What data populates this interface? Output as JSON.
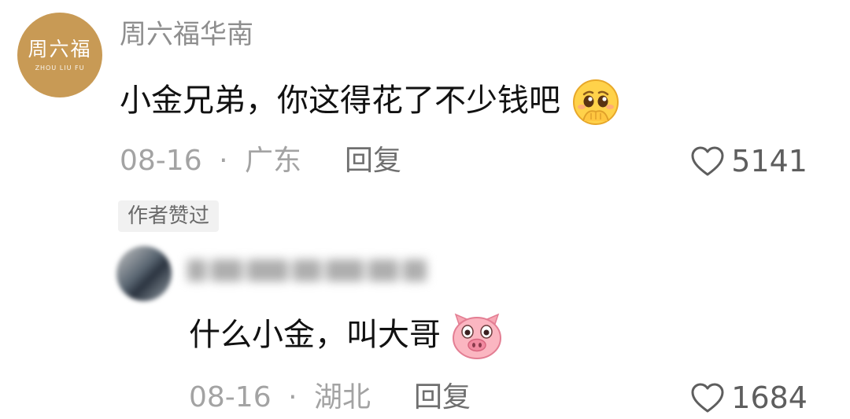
{
  "comments": [
    {
      "username": "周六福华南",
      "avatar": {
        "text": "周六福",
        "subtext": "ZHOU LIU FU",
        "color": "#c89a55"
      },
      "text": "小金兄弟，你这得花了不少钱吧",
      "emoji": "pleading-face-emoji",
      "date": "08-16",
      "separator": "·",
      "location": "广东",
      "reply_label": "回复",
      "likes": "5141",
      "author_liked_badge": "作者赞过"
    },
    {
      "username_blurred": true,
      "text": "什么小金，叫大哥",
      "emoji": "pig-face-emoji",
      "date": "08-16",
      "separator": "·",
      "location": "湖北",
      "reply_label": "回复",
      "likes": "1684"
    }
  ],
  "colors": {
    "brand_gold": "#c89a55",
    "meta_gray": "#a3a3a3",
    "text": "#111111"
  }
}
